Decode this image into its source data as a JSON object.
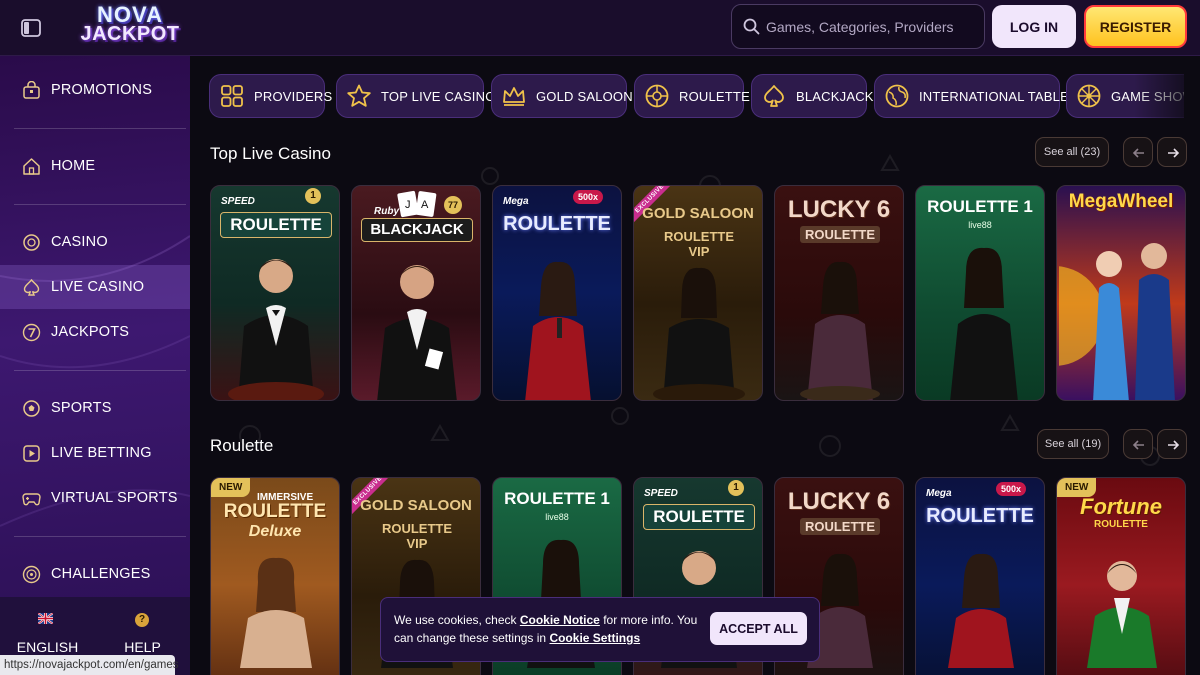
{
  "header": {
    "logo": {
      "line1": "NOVA",
      "line2": "JACKPOT"
    },
    "search_placeholder": "Games, Categories, Providers",
    "login_label": "LOG IN",
    "register_label": "REGISTER"
  },
  "sidebar": {
    "items": [
      {
        "label": "PROMOTIONS",
        "icon": "gift-bag-icon"
      },
      {
        "label": "HOME",
        "icon": "home-icon"
      },
      {
        "label": "CASINO",
        "icon": "casino-chip-icon"
      },
      {
        "label": "LIVE CASINO",
        "icon": "spade-icon",
        "active": true
      },
      {
        "label": "JACKPOTS",
        "icon": "seven-icon"
      },
      {
        "label": "SPORTS",
        "icon": "sports-ball-icon"
      },
      {
        "label": "LIVE BETTING",
        "icon": "live-play-icon"
      },
      {
        "label": "VIRTUAL SPORTS",
        "icon": "gamepad-icon"
      },
      {
        "label": "CHALLENGES",
        "icon": "medal-icon"
      }
    ],
    "language_label": "ENGLISH",
    "help_label": "HELP CENTRE"
  },
  "status_url": "https://novajackpot.com/en/games",
  "categories": [
    {
      "label": "PROVIDERS",
      "icon": "grid-icon"
    },
    {
      "label": "TOP LIVE CASINO",
      "icon": "star-icon"
    },
    {
      "label": "GOLD SALOON",
      "icon": "crown-icon"
    },
    {
      "label": "ROULETTE",
      "icon": "roulette-icon"
    },
    {
      "label": "BLACKJACK",
      "icon": "spade-icon"
    },
    {
      "label": "INTERNATIONAL TABLES",
      "icon": "globe-icon"
    },
    {
      "label": "GAME SHOWS",
      "icon": "wheel-icon"
    }
  ],
  "sections": [
    {
      "title": "Top Live Casino",
      "see_all": "See all (23)",
      "games": [
        {
          "pre": "SPEED",
          "title": "ROULETTE",
          "badge": "1"
        },
        {
          "pre": "Ruby",
          "title": "BLACKJACK",
          "badge": "77"
        },
        {
          "pre": "Mega",
          "title": "ROULETTE",
          "badge": "500x"
        },
        {
          "title": "GOLD SALOON",
          "subtitle": "ROULETTE VIP",
          "ribbon": "EXCLUSIVE"
        },
        {
          "title": "LUCKY 6",
          "subtitle": "ROULETTE"
        },
        {
          "title": "ROULETTE 1",
          "provider": "live88"
        },
        {
          "title": "MegaWheel"
        }
      ]
    },
    {
      "title": "Roulette",
      "see_all": "See all (19)",
      "games": [
        {
          "pre": "IMMERSIVE",
          "title": "ROULETTE",
          "subtitle": "Deluxe",
          "tag": "NEW"
        },
        {
          "title": "GOLD SALOON",
          "subtitle": "ROULETTE VIP",
          "ribbon": "EXCLUSIVE"
        },
        {
          "title": "ROULETTE 1",
          "provider": "live88"
        },
        {
          "pre": "SPEED",
          "title": "ROULETTE",
          "badge": "1"
        },
        {
          "title": "LUCKY 6",
          "subtitle": "ROULETTE"
        },
        {
          "pre": "Mega",
          "title": "ROULETTE",
          "badge": "500x"
        },
        {
          "title": "Fortune",
          "subtitle": "ROULETTE",
          "tag": "NEW"
        }
      ]
    }
  ],
  "cookie": {
    "text_before": "We use cookies, check ",
    "link1": "Cookie Notice",
    "text_middle": " for more info. You can change these settings in ",
    "link2": "Cookie Settings",
    "accept_label": "ACCEPT ALL"
  },
  "colors": {
    "accent": "#ffc21f",
    "sidebar": "#3d1870",
    "chip": "#2d1a4b",
    "background": "#0c0a12"
  }
}
